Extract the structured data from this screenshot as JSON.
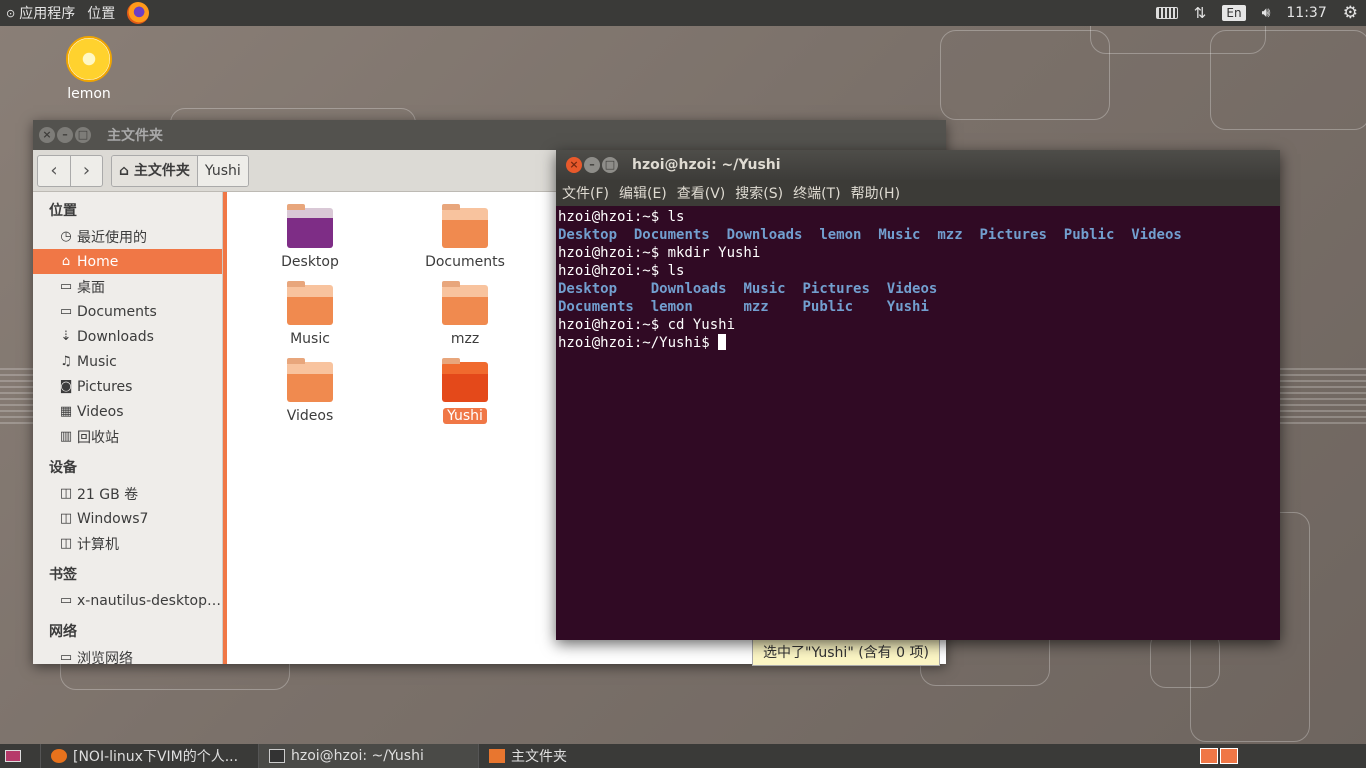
{
  "top_panel": {
    "apps_menu": "应用程序",
    "places_menu": "位置",
    "input_indicator": "En",
    "clock": "11:37"
  },
  "desktop": {
    "icon_label": "lemon"
  },
  "files": {
    "window_title": "主文件夹",
    "breadcrumb": [
      "主文件夹",
      "Yushi"
    ],
    "sidebar": {
      "places_heading": "位置",
      "places": [
        {
          "label": "最近使用的",
          "icon": "clock-icon"
        },
        {
          "label": "Home",
          "icon": "home-icon"
        },
        {
          "label": "桌面",
          "icon": "folder-icon"
        },
        {
          "label": "Documents",
          "icon": "folder-icon"
        },
        {
          "label": "Downloads",
          "icon": "download-icon"
        },
        {
          "label": "Music",
          "icon": "music-icon"
        },
        {
          "label": "Pictures",
          "icon": "camera-icon"
        },
        {
          "label": "Videos",
          "icon": "film-icon"
        },
        {
          "label": "回收站",
          "icon": "trash-icon"
        }
      ],
      "devices_heading": "设备",
      "devices": [
        {
          "label": "21 GB 卷",
          "icon": "drive-icon"
        },
        {
          "label": "Windows7",
          "icon": "drive-icon"
        },
        {
          "label": "计算机",
          "icon": "drive-icon"
        }
      ],
      "bookmarks_heading": "书签",
      "bookmarks": [
        {
          "label": "x-nautilus-desktop…",
          "icon": "folder-icon"
        }
      ],
      "network_heading": "网络",
      "network": [
        {
          "label": "浏览网络",
          "icon": "network-icon"
        }
      ]
    },
    "items": [
      {
        "label": "Desktop"
      },
      {
        "label": "Documents"
      },
      {
        "label": "Music"
      },
      {
        "label": "mzz"
      },
      {
        "label": "Videos"
      },
      {
        "label": "Yushi"
      }
    ],
    "status": "选中了\"Yushi\" (含有 0 项)"
  },
  "terminal": {
    "window_title": "hzoi@hzoi: ~/Yushi",
    "menu": [
      "文件(F)",
      "编辑(E)",
      "查看(V)",
      "搜索(S)",
      "终端(T)",
      "帮助(H)"
    ],
    "lines": {
      "l1": "hzoi@hzoi:~$ ls",
      "l2": [
        "Desktop",
        "Documents",
        "Downloads",
        "lemon",
        "Music",
        "mzz",
        "Pictures",
        "Public",
        "Videos"
      ],
      "l3": "hzoi@hzoi:~$ mkdir Yushi",
      "l4": "hzoi@hzoi:~$ ls",
      "l5": [
        "Desktop",
        "Downloads",
        "Music",
        "Pictures",
        "Videos"
      ],
      "l6": [
        "Documents",
        "lemon",
        "mzz",
        "Public",
        "Yushi"
      ],
      "l7": "hzoi@hzoi:~$ cd Yushi",
      "l8": "hzoi@hzoi:~/Yushi$ "
    }
  },
  "taskbar": {
    "tasks": [
      "[NOI-linux下VIM的个人...",
      "hzoi@hzoi: ~/Yushi",
      "主文件夹"
    ]
  }
}
